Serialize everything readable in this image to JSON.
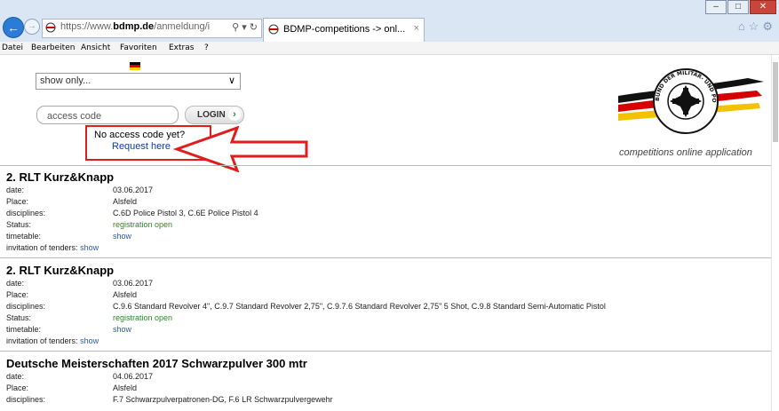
{
  "browser": {
    "url_prefix": "https://www.",
    "url_domain": "bdmp.de",
    "url_suffix": "/anmeldung/i",
    "url_controls": "⚲ ▾ ↻",
    "tab_title": "BDMP-competitions -> onl...",
    "tab_close": "×",
    "toolbar_icons": "⌂☆⚙",
    "window_buttons": [
      "–",
      "□",
      "✕"
    ],
    "back": "←",
    "forward": "→"
  },
  "menu": {
    "items": [
      "Datei",
      "Bearbeiten",
      "Ansicht",
      "Favoriten",
      "Extras",
      "?"
    ]
  },
  "header": {
    "select_value": "show only...",
    "select_arrow": "∨",
    "access_placeholder": "access code",
    "login_label": "LOGIN",
    "login_arrow": "›",
    "no_access": "No access code yet?",
    "request": "Request here",
    "tagline": "competitions online application",
    "logo_text": "BUND DER MILITÄR- UND POLIZEISCHÜTZEN e.V."
  },
  "labels": {
    "date": "date:",
    "place": "Place:",
    "disciplines": "disciplines:",
    "status": "Status:",
    "timetable": "timetable:",
    "invitation": "invitation of tenders:"
  },
  "competitions": [
    {
      "title": "2. RLT Kurz&Knapp",
      "date": "03.06.2017",
      "place": "Alsfeld",
      "disciplines": "C.6D Police Pistol 3, C.6E Police Pistol 4",
      "status": "registration open",
      "timetable": "show",
      "invitation": "show"
    },
    {
      "title": "2. RLT Kurz&Knapp",
      "date": "03.06.2017",
      "place": "Alsfeld",
      "disciplines": "C.9.6 Standard Revolver 4\", C.9.7 Standard Revolver 2,75\", C.9.7.6 Standard Revolver 2,75\" 5 Shot, C.9.8 Standard Semi-Automatic Pistol",
      "status": "registration open",
      "timetable": "show",
      "invitation": "show"
    },
    {
      "title": "Deutsche Meisterschaften 2017 Schwarzpulver 300 mtr",
      "date": "04.06.2017",
      "place": "Alsfeld",
      "disciplines": "F.7 Schwarzpulverpatronen-DG, F.6 LR Schwarzpulvergewehr"
    }
  ],
  "colors": {
    "status_green": "#2a8a2a",
    "link_blue": "#2c5aa0",
    "annotation_red": "#e21c1c"
  }
}
